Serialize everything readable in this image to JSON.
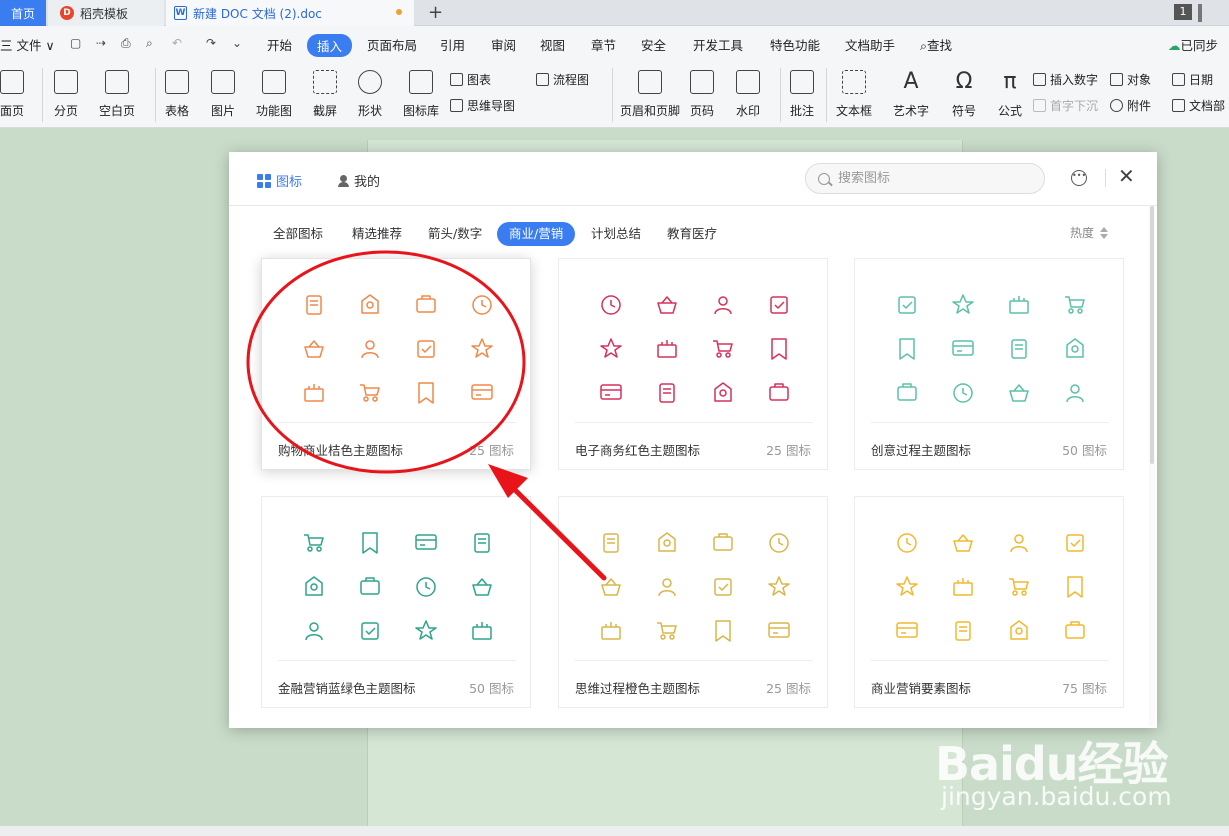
{
  "titlebar": {
    "home_tab": "首页",
    "dk_tab": "稻壳模板",
    "doc_tab": "新建 DOC 文档 (2).doc",
    "plus": "+",
    "page_indicator": "1"
  },
  "menu": {
    "file": "三 文件 ∨",
    "items": [
      "开始",
      "插入",
      "页面布局",
      "引用",
      "审阅",
      "视图",
      "章节",
      "安全",
      "开发工具",
      "特色功能",
      "文档助手"
    ],
    "active": "插入",
    "search": "查找",
    "sync": "已同步"
  },
  "ribbon": {
    "cover": "面页",
    "pagebreak": "分页",
    "blank": "空白页",
    "table": "表格",
    "picture": "图片",
    "funcchart": "功能图",
    "screenshot": "截屏",
    "shape": "形状",
    "iconlib": "图标库",
    "chart": "图表",
    "flowchart": "流程图",
    "mindmap": "思维导图",
    "header_footer": "页眉和页脚",
    "pagenum": "页码",
    "watermark": "水印",
    "comment": "批注",
    "textbox": "文本框",
    "wordart": "艺术字",
    "symbol": "符号",
    "formula": "公式",
    "insert_number": "插入数字",
    "dropcap": "首字下沉",
    "object": "对象",
    "attach": "附件",
    "date": "日期",
    "docpart": "文档部"
  },
  "dialog": {
    "tab_icons": "图标",
    "tab_mine": "我的",
    "search_placeholder": "搜索图标",
    "categories": [
      "全部图标",
      "精选推荐",
      "箭头/数字",
      "商业/营销",
      "计划总结",
      "教育医疗"
    ],
    "active_category": "商业/营销",
    "sort_label": "热度",
    "cards": [
      {
        "name": "购物商业桔色主题图标",
        "count": "25 图标",
        "color": "#f0884a"
      },
      {
        "name": "电子商务红色主题图标",
        "count": "25 图标",
        "color": "#d6315a"
      },
      {
        "name": "创意过程主题图标",
        "count": "50 图标",
        "color": "#5cc0a8"
      },
      {
        "name": "金融营销蓝绿色主题图标",
        "count": "50 图标",
        "color": "#2ea48a"
      },
      {
        "name": "思维过程橙色主题图标",
        "count": "25 图标",
        "color": "#d9b54a"
      },
      {
        "name": "商业营销要素图标",
        "count": "75 图标",
        "color": "#f0b82e"
      }
    ]
  },
  "colors": {
    "accent": "#3a7df0",
    "annotation": "#e8141a",
    "doc_bg": "#c9dcc9"
  },
  "watermark": {
    "brand": "Baidu经验",
    "url": "jingyan.baidu.com"
  }
}
